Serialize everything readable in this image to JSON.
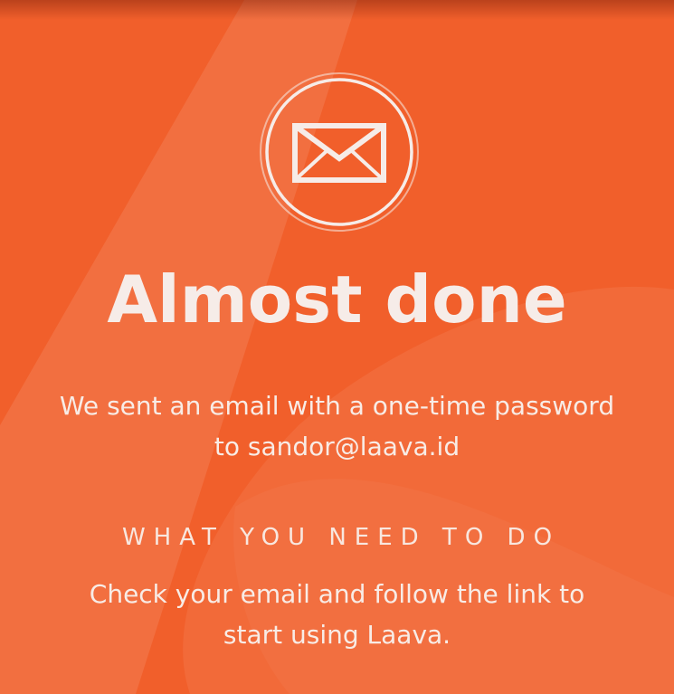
{
  "colors": {
    "background": "#f15f2b",
    "accent_light": "#f6ece8"
  },
  "icon": "envelope-icon",
  "title": "Almost done",
  "message_line_1": "We sent an email with a one-time password",
  "message_line_2": "to sandor@laava.id",
  "section_heading": "WHAT YOU NEED TO DO",
  "instructions_line_1": "Check your email and follow the link to",
  "instructions_line_2": "start using Laava."
}
